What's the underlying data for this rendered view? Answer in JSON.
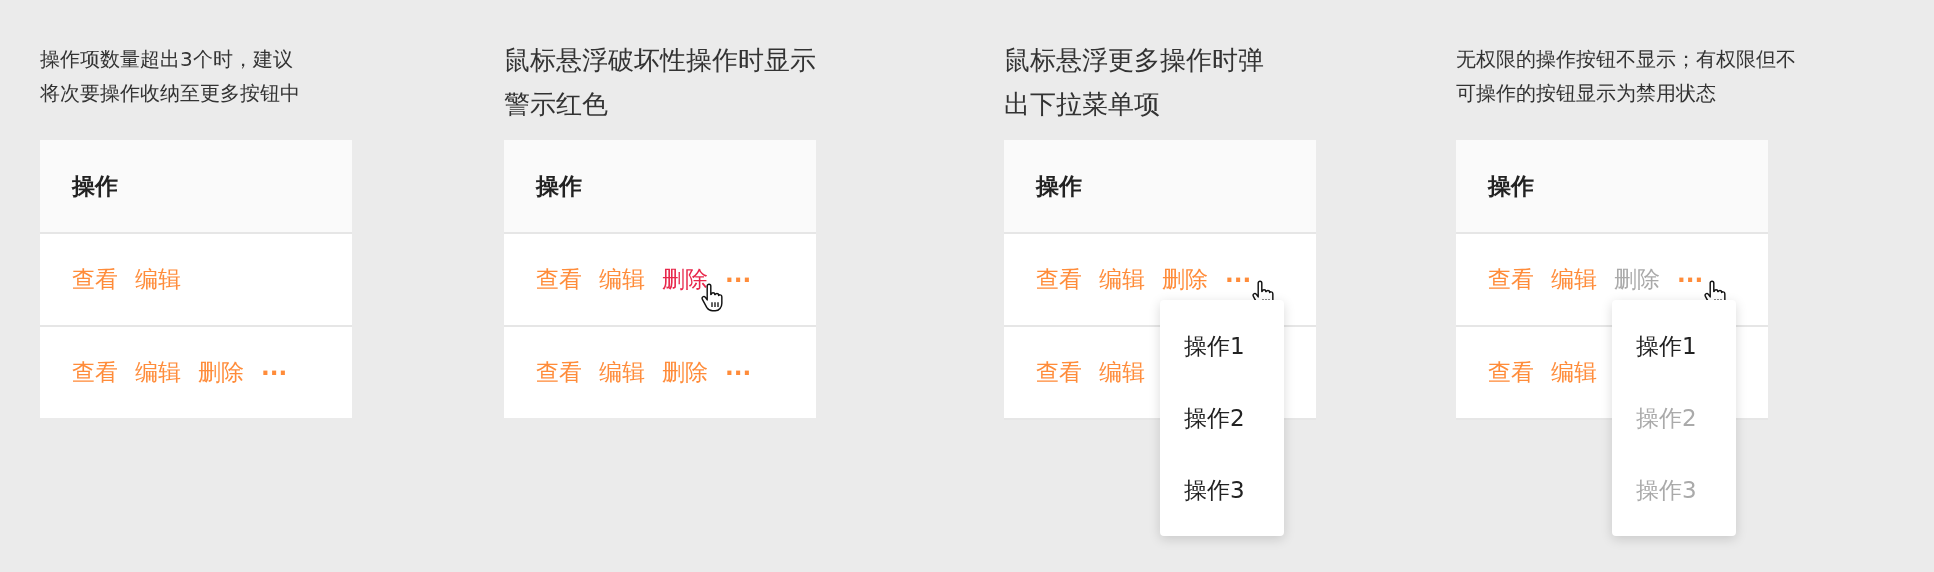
{
  "panels": [
    {
      "caption": "操作项数量超出3个时，建议将次要操作收纳至更多按钮中",
      "header": "操作",
      "rows": [
        {
          "actions": [
            {
              "label": "查看",
              "kind": "link",
              "danger": false,
              "disabled": false,
              "hovered": false
            },
            {
              "label": "编辑",
              "kind": "link",
              "danger": false,
              "disabled": false,
              "hovered": false
            }
          ]
        },
        {
          "actions": [
            {
              "label": "查看",
              "kind": "link",
              "danger": false,
              "disabled": false,
              "hovered": false
            },
            {
              "label": "编辑",
              "kind": "link",
              "danger": false,
              "disabled": false,
              "hovered": false
            },
            {
              "label": "删除",
              "kind": "link",
              "danger": false,
              "disabled": false,
              "hovered": false
            },
            {
              "label": "···",
              "kind": "more",
              "danger": false,
              "disabled": false,
              "hovered": false
            }
          ]
        }
      ]
    },
    {
      "caption": "鼠标悬浮破坏性操作时显示警示红色",
      "header": "操作",
      "rows": [
        {
          "actions": [
            {
              "label": "查看",
              "kind": "link",
              "danger": false,
              "disabled": false,
              "hovered": false
            },
            {
              "label": "编辑",
              "kind": "link",
              "danger": false,
              "disabled": false,
              "hovered": false
            },
            {
              "label": "删除",
              "kind": "link",
              "danger": true,
              "disabled": false,
              "hovered": true
            },
            {
              "label": "···",
              "kind": "more",
              "danger": false,
              "disabled": false,
              "hovered": false
            }
          ]
        },
        {
          "actions": [
            {
              "label": "查看",
              "kind": "link",
              "danger": false,
              "disabled": false,
              "hovered": false
            },
            {
              "label": "编辑",
              "kind": "link",
              "danger": false,
              "disabled": false,
              "hovered": false
            },
            {
              "label": "删除",
              "kind": "link",
              "danger": false,
              "disabled": false,
              "hovered": false
            },
            {
              "label": "···",
              "kind": "more",
              "danger": false,
              "disabled": false,
              "hovered": false
            }
          ]
        }
      ]
    },
    {
      "caption": "鼠标悬浮更多操作时弹出下拉菜单项",
      "header": "操作",
      "rows": [
        {
          "actions": [
            {
              "label": "查看",
              "kind": "link",
              "danger": false,
              "disabled": false,
              "hovered": false
            },
            {
              "label": "编辑",
              "kind": "link",
              "danger": false,
              "disabled": false,
              "hovered": false
            },
            {
              "label": "删除",
              "kind": "link",
              "danger": false,
              "disabled": false,
              "hovered": false
            },
            {
              "label": "···",
              "kind": "more",
              "danger": false,
              "disabled": false,
              "hovered": true
            }
          ]
        },
        {
          "actions": [
            {
              "label": "查看",
              "kind": "link",
              "danger": false,
              "disabled": false,
              "hovered": false
            },
            {
              "label": "编辑",
              "kind": "link",
              "danger": false,
              "disabled": false,
              "hovered": false
            }
          ]
        }
      ],
      "menu": [
        {
          "label": "操作1",
          "disabled": false
        },
        {
          "label": "操作2",
          "disabled": false
        },
        {
          "label": "操作3",
          "disabled": false
        }
      ]
    },
    {
      "caption": "无权限的操作按钮不显示；有权限但不可操作的按钮显示为禁用状态",
      "header": "操作",
      "rows": [
        {
          "actions": [
            {
              "label": "查看",
              "kind": "link",
              "danger": false,
              "disabled": false,
              "hovered": false
            },
            {
              "label": "编辑",
              "kind": "link",
              "danger": false,
              "disabled": false,
              "hovered": false
            },
            {
              "label": "删除",
              "kind": "link",
              "danger": false,
              "disabled": true,
              "hovered": false
            },
            {
              "label": "···",
              "kind": "more",
              "danger": false,
              "disabled": false,
              "hovered": true
            }
          ]
        },
        {
          "actions": [
            {
              "label": "查看",
              "kind": "link",
              "danger": false,
              "disabled": false,
              "hovered": false
            },
            {
              "label": "编辑",
              "kind": "link",
              "danger": false,
              "disabled": false,
              "hovered": false
            }
          ]
        }
      ],
      "menu": [
        {
          "label": "操作1",
          "disabled": false
        },
        {
          "label": "操作2",
          "disabled": true
        },
        {
          "label": "操作3",
          "disabled": true
        }
      ]
    }
  ]
}
